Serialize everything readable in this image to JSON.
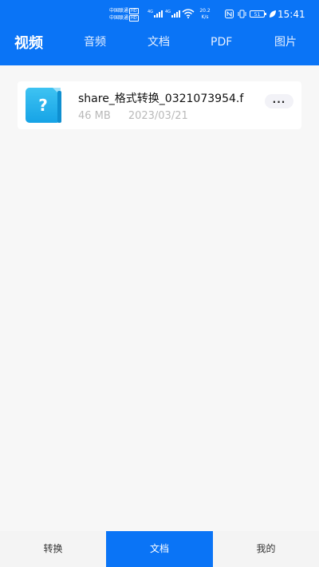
{
  "status_bar": {
    "carrier_1": "中国联通",
    "carrier_2": "中国联通",
    "hd_label": "HD",
    "signal_1_label": "4G",
    "signal_2_label": "4G",
    "net_speed_value": "20.2",
    "net_speed_unit": "K/s",
    "battery": "51",
    "time": "15:41"
  },
  "tabs": [
    {
      "label": "视频",
      "active": true
    },
    {
      "label": "音频",
      "active": false
    },
    {
      "label": "文档",
      "active": false
    },
    {
      "label": "PDF",
      "active": false
    },
    {
      "label": "图片",
      "active": false
    }
  ],
  "files": [
    {
      "icon": "unknown-file-icon",
      "icon_glyph": "?",
      "name": "share_格式转换_0321073954.f",
      "size": "46 MB",
      "date": "2023/03/21",
      "more_label": "..."
    }
  ],
  "bottom_nav": [
    {
      "label": "转换",
      "active": false
    },
    {
      "label": "文档",
      "active": true
    },
    {
      "label": "我的",
      "active": false
    }
  ],
  "colors": {
    "primary": "#0a74f6",
    "background": "#f7f7f7",
    "card": "#ffffff",
    "meta_text": "#b9b9b9"
  }
}
